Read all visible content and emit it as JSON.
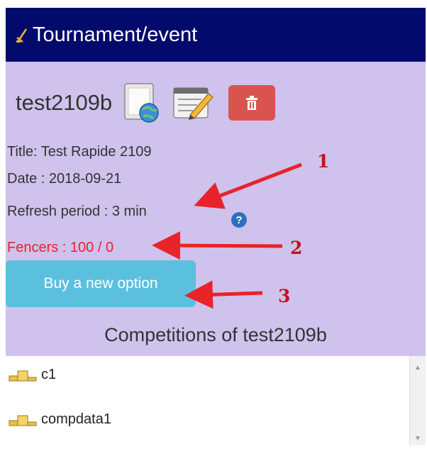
{
  "header": {
    "title": "Tournament/event"
  },
  "event": {
    "name": "test2109b"
  },
  "info": {
    "title": "Title: Test Rapide 2109",
    "date": "Date : 2018-09-21",
    "refresh": "Refresh period : 3 min",
    "help_glyph": "?",
    "fencers": "Fencers : 100 / 0"
  },
  "buy_button": {
    "label": "Buy a new option"
  },
  "competitions": {
    "heading": "Competitions of test2109b",
    "items": [
      {
        "label": "c1"
      },
      {
        "label": "compdata1"
      }
    ]
  },
  "annotations": {
    "one": "1",
    "two": "2",
    "three": "3"
  },
  "colors": {
    "header_bg": "#020a6b",
    "panel_bg": "#cfc2ec",
    "danger": "#d9534f",
    "info_btn": "#5bc0de",
    "fencers_text": "#e8232a",
    "annotation": "#e8232a"
  }
}
